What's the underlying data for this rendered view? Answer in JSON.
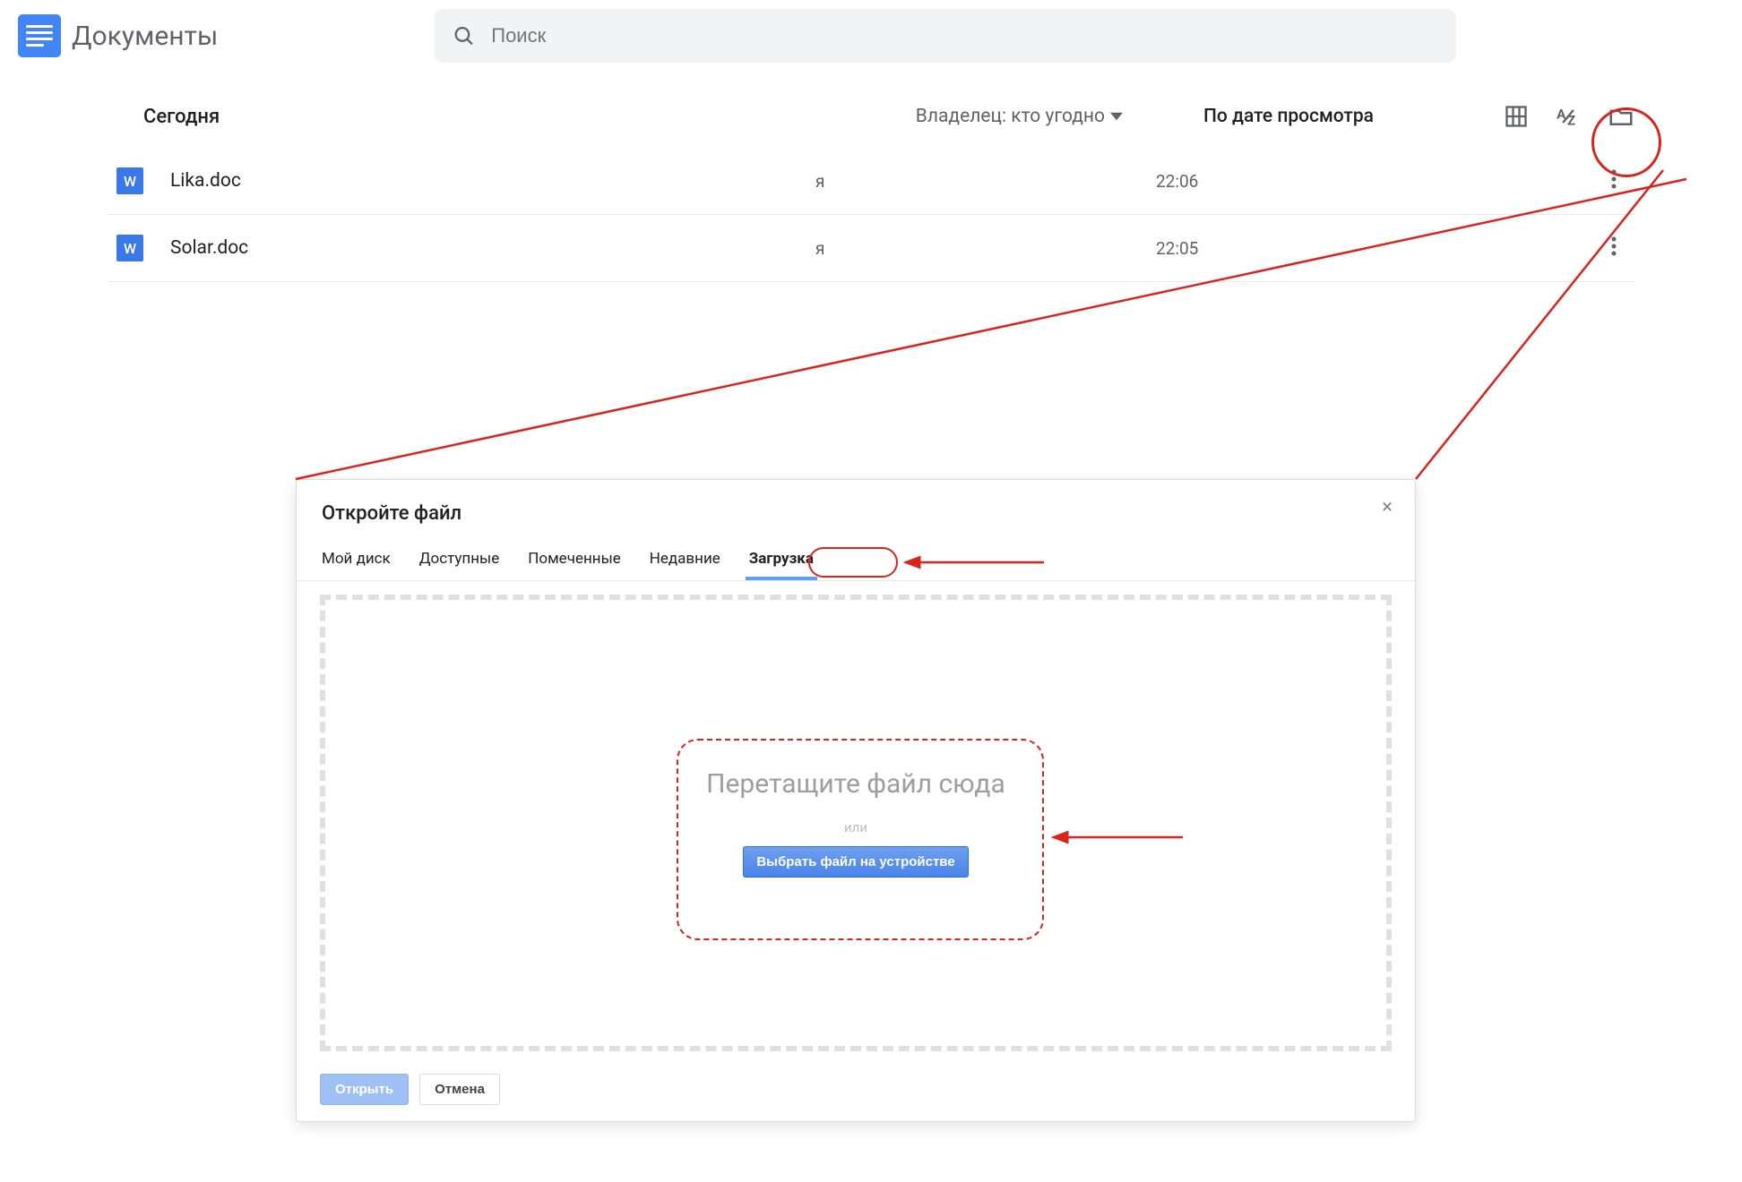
{
  "header": {
    "app_title": "Документы",
    "search_placeholder": "Поиск"
  },
  "toolbar": {
    "section": "Сегодня",
    "owner_filter": "Владелец: кто угодно",
    "sort_label": "По дате просмотра"
  },
  "docs": [
    {
      "icon_letter": "W",
      "name": "Lika.doc",
      "owner": "я",
      "date": "22:06"
    },
    {
      "icon_letter": "W",
      "name": "Solar.doc",
      "owner": "я",
      "date": "22:05"
    }
  ],
  "dialog": {
    "title": "Откройте файл",
    "tabs": [
      "Мой диск",
      "Доступные",
      "Помеченные",
      "Недавние",
      "Загрузка"
    ],
    "drop_text": "Перетащите файл сюда",
    "drop_or": "или",
    "drop_button": "Выбрать файл на устройстве",
    "open": "Открыть",
    "cancel": "Отмена"
  }
}
